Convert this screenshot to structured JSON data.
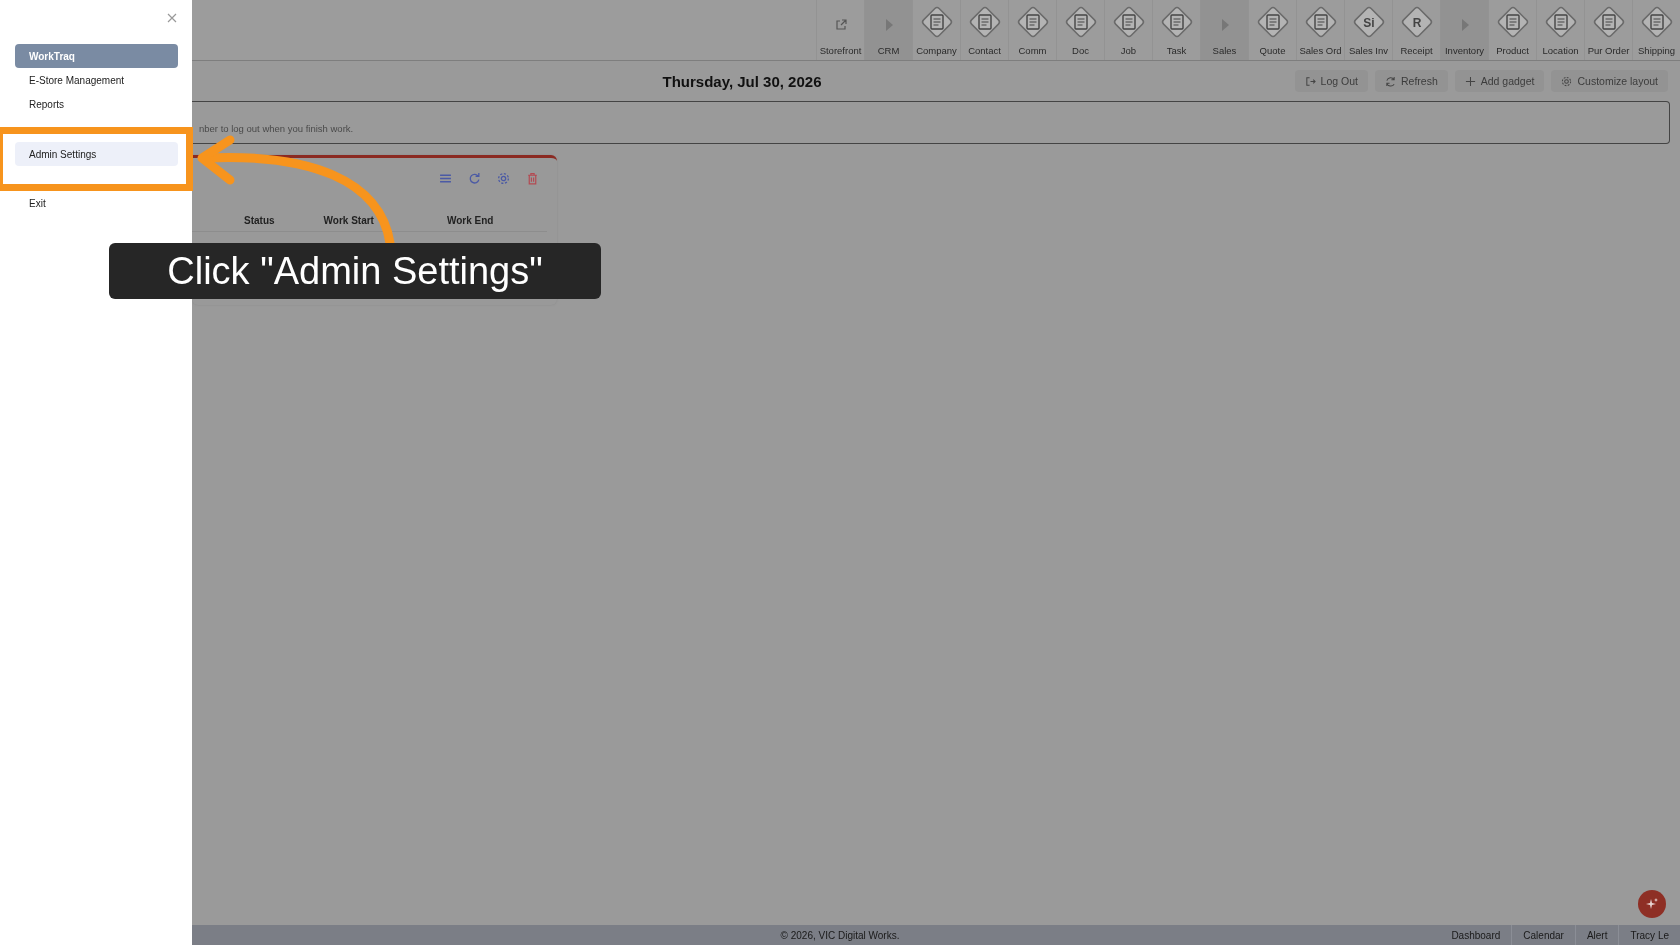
{
  "toolbar": [
    {
      "label": "Storefront",
      "kind": "link"
    },
    {
      "label": "CRM",
      "kind": "group"
    },
    {
      "label": "Company",
      "kind": "module"
    },
    {
      "label": "Contact",
      "kind": "module"
    },
    {
      "label": "Comm",
      "kind": "module"
    },
    {
      "label": "Doc",
      "kind": "module"
    },
    {
      "label": "Job",
      "kind": "module"
    },
    {
      "label": "Task",
      "kind": "module"
    },
    {
      "label": "Sales",
      "kind": "group"
    },
    {
      "label": "Quote",
      "kind": "module"
    },
    {
      "label": "Sales Ord",
      "kind": "module"
    },
    {
      "label": "Sales Inv",
      "kind": "module",
      "icon_text": "Si"
    },
    {
      "label": "Receipt",
      "kind": "module",
      "icon_text": "R"
    },
    {
      "label": "Inventory",
      "kind": "group"
    },
    {
      "label": "Product",
      "kind": "module"
    },
    {
      "label": "Location",
      "kind": "module"
    },
    {
      "label": "Pur Order",
      "kind": "module"
    },
    {
      "label": "Shipping",
      "kind": "module"
    }
  ],
  "header": {
    "date": "Thursday, Jul 30, 2026",
    "buttons": [
      {
        "label": "Log Out",
        "kind": "logout"
      },
      {
        "label": "Refresh",
        "kind": "refresh"
      },
      {
        "label": "Add gadget",
        "kind": "add"
      },
      {
        "label": "Customize layout",
        "kind": "settings"
      }
    ]
  },
  "notice": {
    "text": "nber to log out when you finish work."
  },
  "gadget": {
    "columns": [
      "Status",
      "Work Start",
      "Work End"
    ]
  },
  "footer": {
    "copyright": "© 2026, VIC Digital Works.",
    "links": [
      "Dashboard",
      "Calendar",
      "Alert",
      "Tracy Le"
    ]
  },
  "drawer": {
    "items": [
      {
        "label": "WorkTraq",
        "selected": true,
        "hovered": false
      },
      {
        "label": "E-Store Management",
        "selected": false,
        "hovered": false
      },
      {
        "label": "Reports",
        "selected": false,
        "hovered": false
      },
      {
        "label": "Admin Settings",
        "selected": false,
        "hovered": true
      },
      {
        "label": "Exit",
        "selected": false,
        "hovered": false
      }
    ]
  },
  "callout": {
    "text": "Click \"Admin Settings\""
  }
}
